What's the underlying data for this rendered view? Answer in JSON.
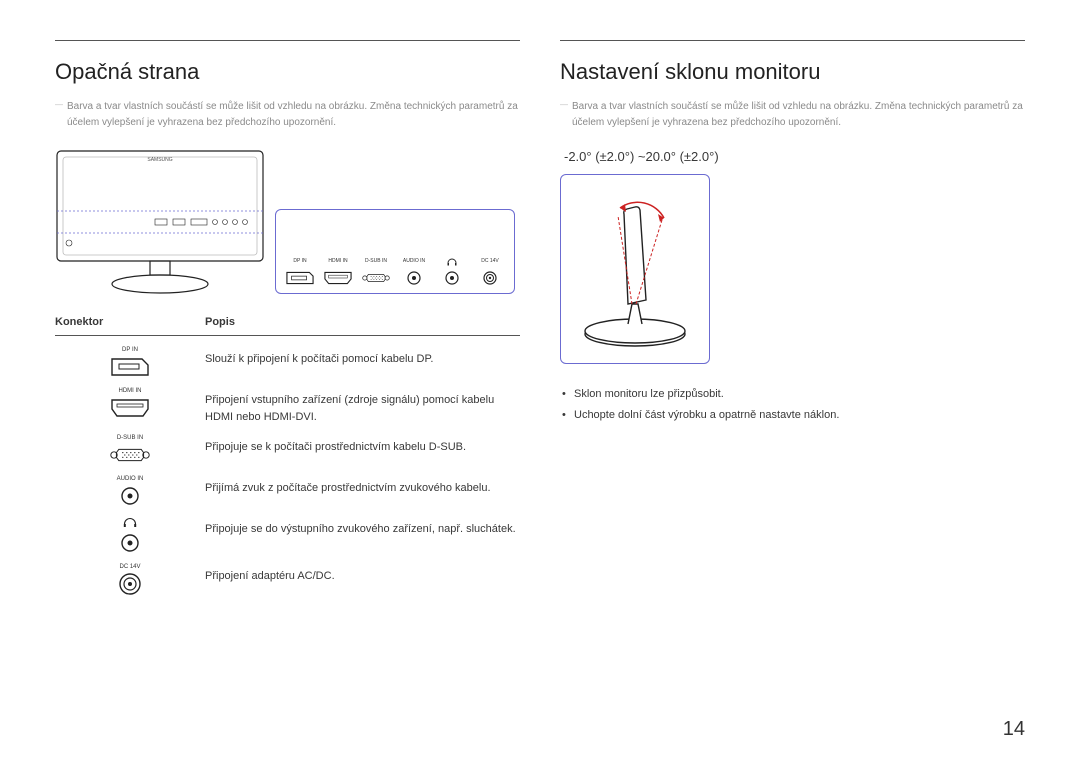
{
  "left": {
    "heading": "Opačná strana",
    "note": "Barva a tvar vlastních součástí se může lišit od vzhledu na obrázku. Změna technických parametrů za účelem vylepšení je vyhrazena bez předchozího upozornění.",
    "ports": [
      {
        "name": "DP IN"
      },
      {
        "name": "HDMI IN"
      },
      {
        "name": "D-SUB IN"
      },
      {
        "name": "AUDIO IN"
      },
      {
        "name": "headphone",
        "glyph": "♫"
      },
      {
        "name": "DC 14V"
      }
    ],
    "table": {
      "head_conn": "Konektor",
      "head_desc": "Popis",
      "rows": [
        {
          "label": "DP IN",
          "icon": "dp",
          "desc": "Slouží k připojení k počítači pomocí kabelu DP."
        },
        {
          "label": "HDMI IN",
          "icon": "hdmi",
          "desc": "Připojení vstupního zařízení (zdroje signálu) pomocí kabelu HDMI nebo HDMI-DVI."
        },
        {
          "label": "D-SUB IN",
          "icon": "dsub",
          "desc": "Připojuje se k počítači prostřednictvím kabelu D-SUB."
        },
        {
          "label": "AUDIO IN",
          "icon": "jack",
          "desc": "Přijímá zvuk z počítače prostřednictvím zvukového kabelu."
        },
        {
          "label": "",
          "icon": "hp",
          "desc": "Připojuje se do výstupního zvukového zařízení, např. sluchátek."
        },
        {
          "label": "DC 14V",
          "icon": "dc",
          "desc": "Připojení adaptéru AC/DC."
        }
      ]
    }
  },
  "right": {
    "heading": "Nastavení sklonu monitoru",
    "note": "Barva a tvar vlastních součástí se může lišit od vzhledu na obrázku. Změna technických parametrů za účelem vylepšení je vyhrazena bez předchozího upozornění.",
    "tilt_spec": "-2.0° (±2.0°) ~20.0° (±2.0°)",
    "bullets": [
      "Sklon monitoru lze přizpůsobit.",
      "Uchopte dolní část výrobku a opatrně nastavte náklon."
    ]
  },
  "page_number": "14"
}
